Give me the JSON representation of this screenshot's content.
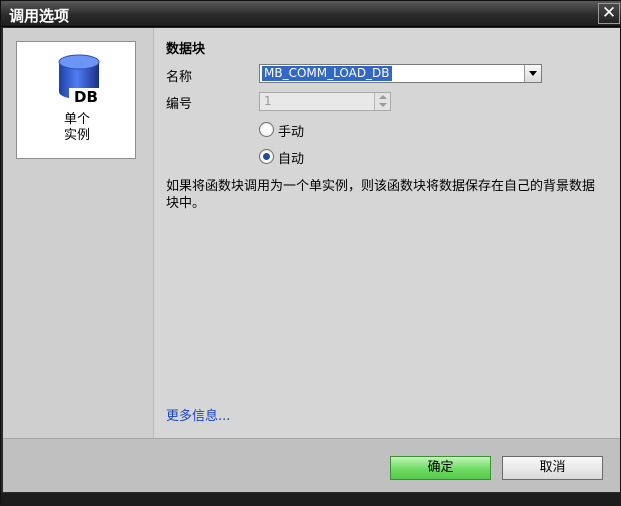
{
  "window": {
    "title": "调用选项",
    "close_label": "✕"
  },
  "left_panel": {
    "card_label_line1": "单个",
    "card_label_line2": "实例",
    "icon_text": "DB"
  },
  "form": {
    "section_title": "数据块",
    "name_label": "名称",
    "name_value": "MB_COMM_LOAD_DB",
    "number_label": "编号",
    "number_value": "1",
    "radio_manual": "手动",
    "radio_auto": "自动",
    "description": "如果将函数块调用为一个单实例，则该函数块将数据保存在自己的背景数据块中。",
    "more_info": "更多信息..."
  },
  "footer": {
    "ok_label": "确定",
    "cancel_label": "取消"
  },
  "colors": {
    "accent_selection": "#3168c6",
    "ok_green": "#6fdb63",
    "link_blue": "#1a45c8"
  }
}
